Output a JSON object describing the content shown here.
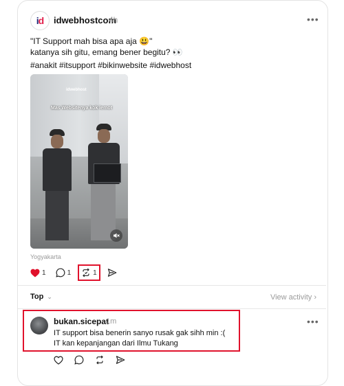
{
  "post": {
    "username": "idwebhostcom",
    "time": "4h",
    "text": "\"IT Support mah bisa apa aja 😃\"\nkatanya sih gitu, emang bener begitu? 👀",
    "hashtags": "#anakit #itsupport #bikinwebsite #idwebhost",
    "media": {
      "brand": "idwebhost",
      "caption": "Mas Websitenya kok lemot"
    },
    "location": "Yogyakarta",
    "likes": "1",
    "comments": "1",
    "reposts": "1",
    "more": "•••"
  },
  "replies_header": {
    "sort_label": "Top",
    "view_activity": "View activity"
  },
  "reply": {
    "username": "bukan.sicepat",
    "time": "1m",
    "text": "IT support bisa benerin sanyo rusak gak sihh min :(\nIT kan kepanjangan dari Ilmu Tukang",
    "more": "•••"
  },
  "colors": {
    "like": "#e0112b",
    "highlight": "#e0112b",
    "muted": "#9a9a9a"
  },
  "icons": [
    "heart-icon",
    "comment-icon",
    "repost-icon",
    "share-icon",
    "more-icon",
    "mute-icon",
    "chevron-down-icon",
    "chevron-right-icon"
  ]
}
